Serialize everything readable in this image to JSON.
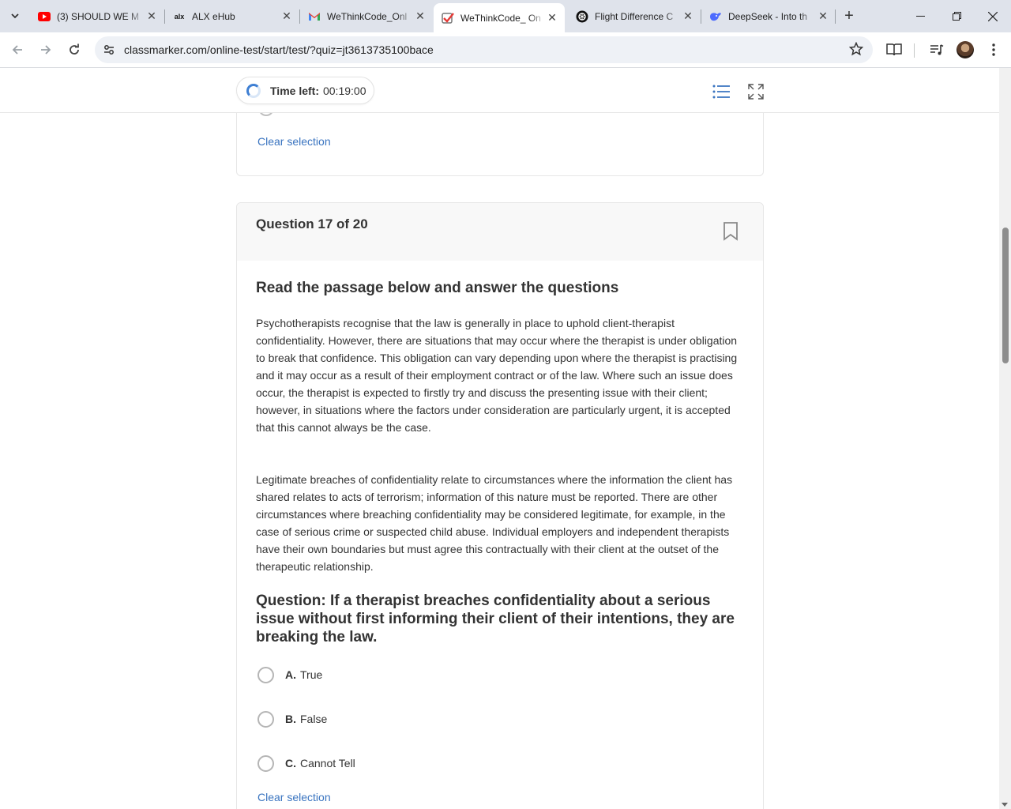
{
  "browser": {
    "tabs": [
      {
        "title": "(3) SHOULD WE M",
        "icon": "youtube-icon",
        "active": false
      },
      {
        "title": "ALX eHub",
        "icon": "alx-icon",
        "active": false
      },
      {
        "title": "WeThinkCode_Onl",
        "icon": "gmail-icon",
        "active": false
      },
      {
        "title": "WeThinkCode_ On",
        "icon": "checkmark-icon",
        "active": true
      },
      {
        "title": "Flight Difference C",
        "icon": "chatgpt-icon",
        "active": false
      },
      {
        "title": "DeepSeek - Into th",
        "icon": "deepseek-icon",
        "active": false
      }
    ],
    "url": "classmarker.com/online-test/start/test/?quiz=jt3613735100bace"
  },
  "timer": {
    "label": "Time left:",
    "value": "00:19:00"
  },
  "previous_question": {
    "clear_label": "Clear selection"
  },
  "question": {
    "number_label": "Question 17 of 20",
    "passage_title": "Read the passage below and answer the questions",
    "paragraphs": [
      "Psychotherapists recognise that the law is generally in place to uphold client-therapist confidentiality. However, there are situations that may occur where the therapist is under obligation to break that confidence. This obligation can vary depending upon where the therapist is practising and it may occur as a result of their employment contract or of the law. Where such an issue does occur, the therapist is expected to firstly try and discuss the presenting issue with their client; however, in situations where the factors under consideration are particularly urgent, it is accepted that this cannot always be the case.",
      "Legitimate breaches of confidentiality relate to circumstances where the information the client has shared relates to acts of terrorism; information of this nature must be reported. There are other circumstances where breaching confidentiality may be considered legitimate, for example, in the case of serious crime or suspected child abuse. Individual employers and independent therapists have their own boundaries but must agree this contractually with their client at the outset of the therapeutic relationship."
    ],
    "prompt": "Question: If a therapist breaches confidentiality about a serious issue without first informing their client of their intentions, they are breaking the law.",
    "options": [
      {
        "letter": "A.",
        "text": "True"
      },
      {
        "letter": "B.",
        "text": "False"
      },
      {
        "letter": "C.",
        "text": "Cannot Tell"
      }
    ],
    "clear_label": "Clear selection"
  }
}
